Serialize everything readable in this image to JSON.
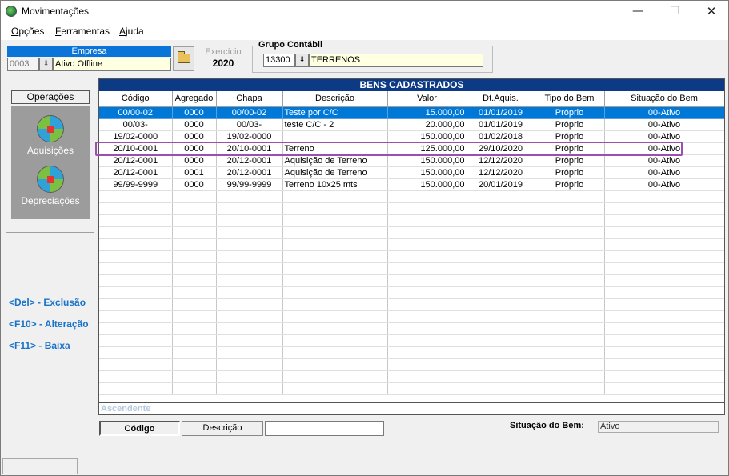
{
  "window": {
    "title": "Movimentações",
    "min_glyph": "—",
    "max_glyph": "☐",
    "close_glyph": "✕"
  },
  "menu": {
    "opcoes": {
      "first": "O",
      "rest": "pções"
    },
    "ferramentas": {
      "first": "F",
      "rest": "erramentas"
    },
    "ajuda": {
      "first": "A",
      "rest": "juda"
    }
  },
  "empresa": {
    "label": "Empresa",
    "code": "0003",
    "name": "Ativo Offline",
    "pick_glyph": "⬇"
  },
  "exercicio": {
    "label": "Exercício",
    "value": "2020"
  },
  "grupo_contabil": {
    "label": "Grupo  Contábil",
    "code": "13300",
    "name": "TERRENOS",
    "pick_glyph": "⬇"
  },
  "operacoes": {
    "header": "Operações",
    "items": [
      {
        "label": "Aquisições",
        "icon": "globe-icon"
      },
      {
        "label": "Depreciações",
        "icon": "globe-icon"
      }
    ]
  },
  "shortcuts": [
    "<Del> - Exclusão",
    "<F10> - Alteração",
    "<F11> - Baixa"
  ],
  "grid": {
    "title": "BENS CADASTRADOS",
    "columns": [
      "Código",
      "Agregado",
      "Chapa",
      "Descrição",
      "Valor",
      "Dt.Aquis.",
      "Tipo do Bem",
      "Situação do Bem"
    ],
    "rows": [
      [
        "00/00-02",
        "0000",
        "00/00-02",
        "Teste por C/C",
        "15.000,00",
        "01/01/2019",
        "Próprio",
        "00-Ativo"
      ],
      [
        "00/03-",
        "0000",
        "00/03-",
        "teste C/C - 2",
        "20.000,00",
        "01/01/2019",
        "Próprio",
        "00-Ativo"
      ],
      [
        "19/02-0000",
        "0000",
        "19/02-0000",
        "",
        "150.000,00",
        "01/02/2018",
        "Próprio",
        "00-Ativo"
      ],
      [
        "20/10-0001",
        "0000",
        "20/10-0001",
        "Terreno",
        "125.000,00",
        "29/10/2020",
        "Próprio",
        "00-Ativo"
      ],
      [
        "20/12-0001",
        "0000",
        "20/12-0001",
        "Aquisição de Terreno",
        "150.000,00",
        "12/12/2020",
        "Próprio",
        "00-Ativo"
      ],
      [
        "20/12-0001",
        "0001",
        "20/12-0001",
        "Aquisição de Terreno",
        "150.000,00",
        "12/12/2020",
        "Próprio",
        "00-Ativo"
      ],
      [
        "99/99-9999",
        "0000",
        "99/99-9999",
        "Terreno 10x25 mts",
        "150.000,00",
        "20/01/2019",
        "Próprio",
        "00-Ativo"
      ]
    ],
    "selected_row": 0,
    "highlighted_row": 3,
    "sort_label": "Ascendente"
  },
  "sort": {
    "codigo": "Código",
    "descricao": "Descrição",
    "search_value": ""
  },
  "situacao": {
    "label": "Situação do Bem:",
    "value": "Ativo"
  }
}
